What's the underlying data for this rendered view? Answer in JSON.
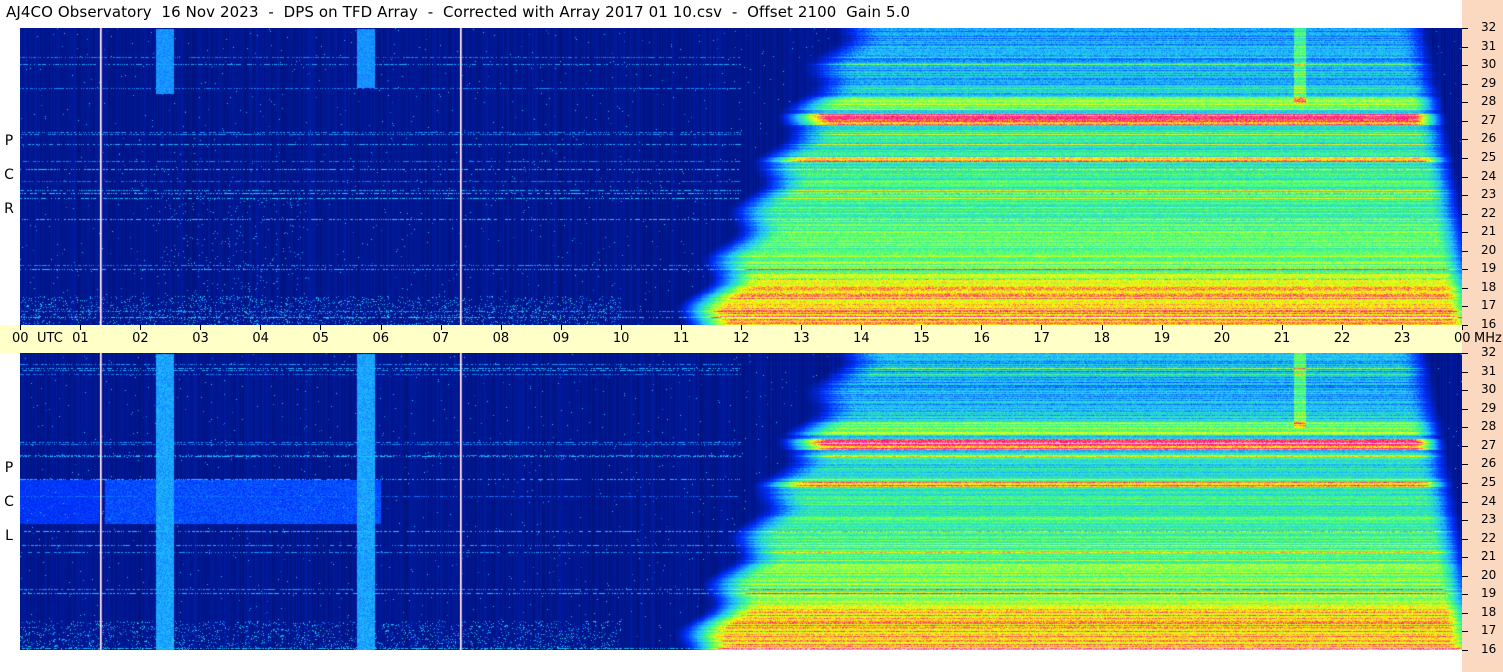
{
  "header": {
    "title": "AJ4CO Observatory  16 Nov 2023  -  DPS on TFD Array  -  Corrected with Array 2017 01 10.csv  -  Offset 2100  Gain 5.0"
  },
  "colors": {
    "background": "#00002a",
    "time_strip": "#ffffc8",
    "freq_strip": "#fbd8c0",
    "marker_line_pink": "#ff80c0",
    "marker_line_white": "#ffffff"
  },
  "chart_data": {
    "type": "heatmap",
    "panels": [
      {
        "name": "RCP",
        "label": [
          "R",
          "C",
          "P"
        ]
      },
      {
        "name": "LCP",
        "label": [
          "L",
          "C",
          "P"
        ]
      }
    ],
    "x_label": "UTC",
    "x_ticks": [
      "00",
      "01",
      "02",
      "03",
      "04",
      "05",
      "06",
      "07",
      "08",
      "09",
      "10",
      "11",
      "12",
      "13",
      "14",
      "15",
      "16",
      "17",
      "18",
      "19",
      "20",
      "21",
      "22",
      "23",
      "00"
    ],
    "x_range_hours": [
      0,
      24
    ],
    "y_label": "MHz",
    "y_ticks": [
      "32",
      "31",
      "30",
      "29",
      "28",
      "27",
      "26",
      "25",
      "24",
      "23",
      "22",
      "21",
      "20",
      "19",
      "18",
      "17",
      "16"
    ],
    "y_range_mhz": [
      16,
      32
    ],
    "marker_lines_utc_hours": [
      1.33,
      7.33
    ],
    "colormap": [
      "#00002a",
      "#0030ff",
      "#20c0ff",
      "#40ff80",
      "#ffff00",
      "#ff0090",
      "#ffffff"
    ]
  }
}
